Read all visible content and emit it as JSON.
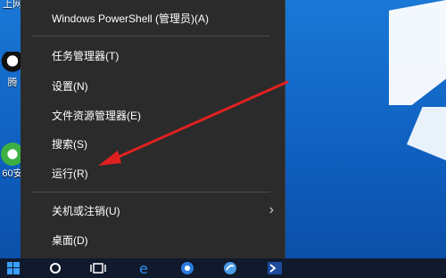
{
  "desktop": {
    "icons": [
      {
        "label": "上网",
        "icon": "browser-icon"
      },
      {
        "label": "腾",
        "icon": "qq-icon"
      },
      {
        "label": "60安",
        "icon": "360-security-icon"
      }
    ]
  },
  "menu": {
    "items": [
      {
        "label": "Windows PowerShell (管理员)(A)"
      },
      {
        "label": "任务管理器(T)"
      },
      {
        "label": "设置(N)"
      },
      {
        "label": "文件资源管理器(E)"
      },
      {
        "label": "搜索(S)"
      },
      {
        "label": "运行(R)"
      },
      {
        "label": "关机或注销(U)"
      },
      {
        "label": "桌面(D)"
      }
    ]
  },
  "annotation": {
    "color": "#e02020"
  },
  "taskbar": {
    "icons": [
      "windows-start-icon",
      "cortana-search-icon",
      "task-view-icon",
      "edge-icon",
      "app-icon",
      "browser-icon",
      "powershell-icon"
    ]
  }
}
